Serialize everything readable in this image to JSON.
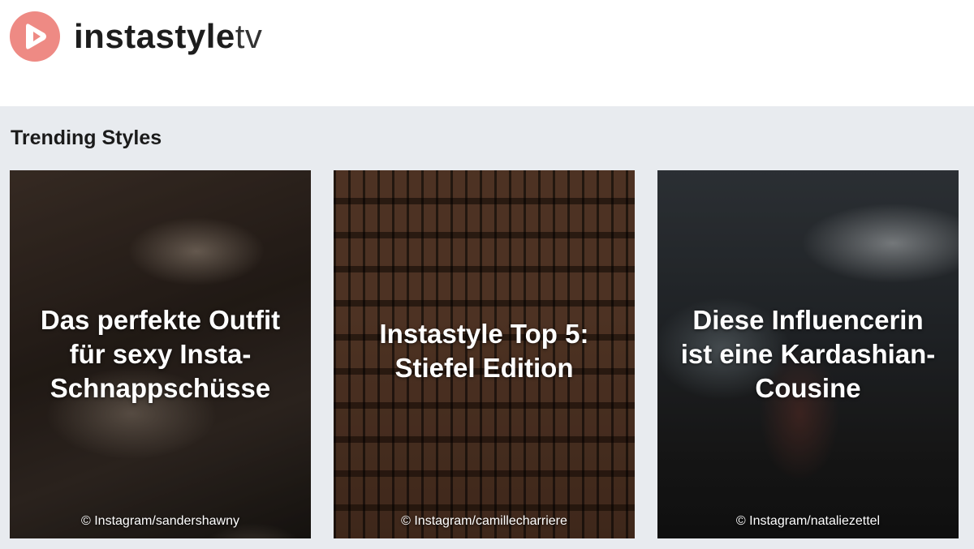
{
  "brand": {
    "name": "instastyle",
    "suffix": "tv",
    "logo_color": "#ee8a84",
    "icon": "play-heart-icon"
  },
  "section": {
    "title": "Trending Styles"
  },
  "cards": [
    {
      "title": "Das perfekte Outfit für sexy Insta-Schnappschüsse",
      "credit": "© Instagram/sandershawny"
    },
    {
      "title": "Instastyle Top 5: Stiefel Edition",
      "credit": "© Instagram/camillecharriere"
    },
    {
      "title": "Diese Influencerin ist eine Kardashian-Cousine",
      "credit": "© Instagram/nataliezettel"
    }
  ]
}
